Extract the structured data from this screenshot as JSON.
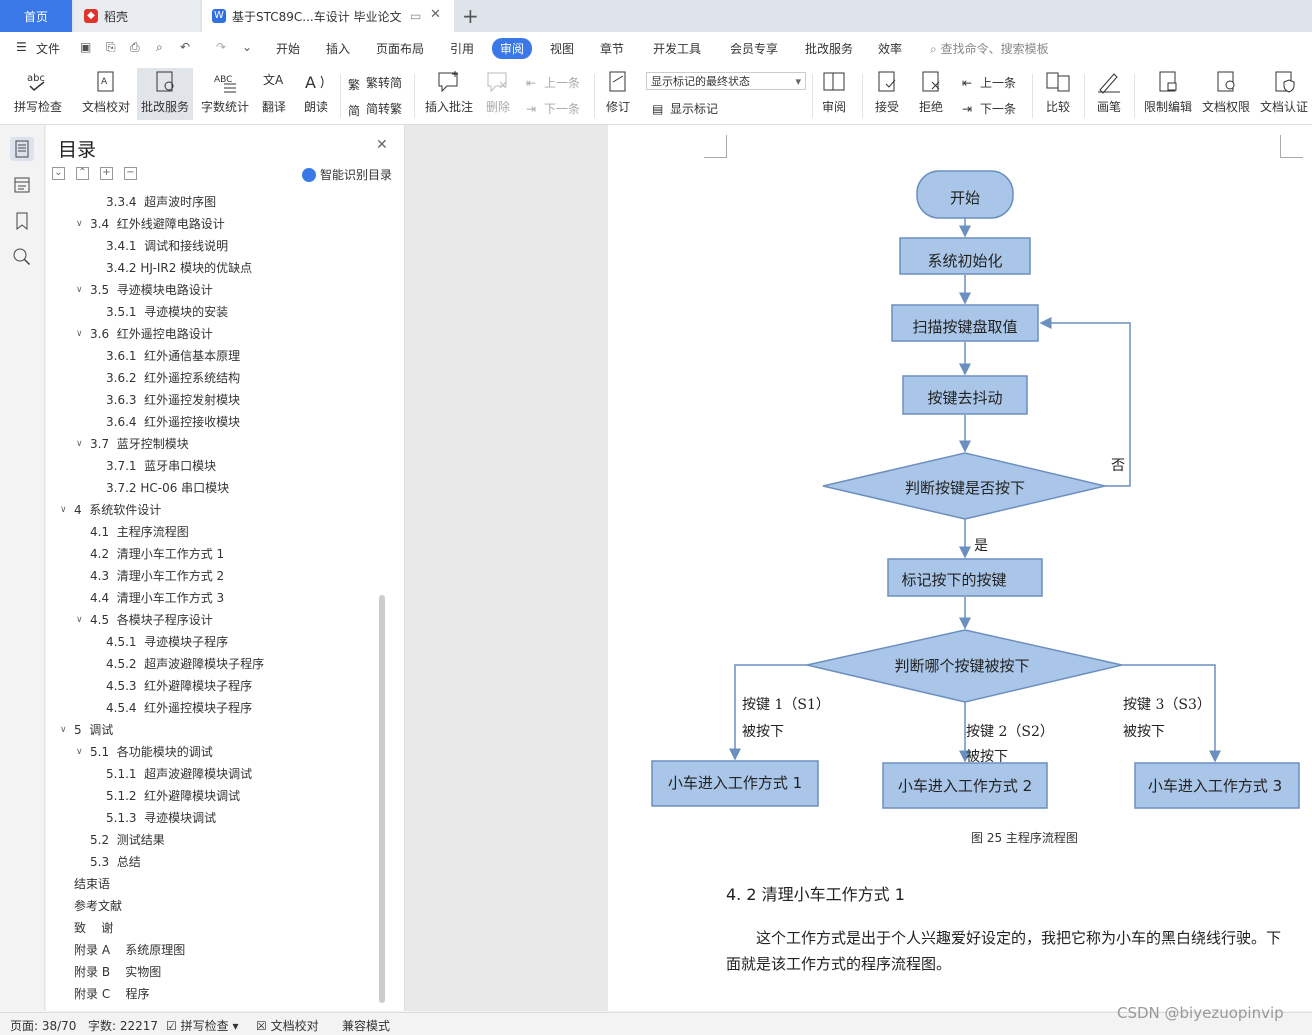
{
  "tabs": {
    "home": "首页",
    "daoke": "稻壳",
    "doc": "基于STC89C...车设计 毕业论文"
  },
  "menu": [
    "文件",
    "开始",
    "插入",
    "页面布局",
    "引用",
    "审阅",
    "视图",
    "章节",
    "开发工具",
    "会员专享",
    "批改服务",
    "效率"
  ],
  "search_placeholder": "查找命令、搜索模板",
  "ribbon": {
    "spell": "拼写检查",
    "proof": "文档校对",
    "correct": "批改服务",
    "wordcount": "字数统计",
    "translate": "翻译",
    "read": "朗读",
    "t2s": "繁转简",
    "s2t": "简转繁",
    "insert_comment": "插入批注",
    "delete": "删除",
    "prev": "上一条",
    "next": "下一条",
    "revise": "修订",
    "markup_state": "显示标记的最终状态",
    "show_markup": "显示标记",
    "review": "审阅",
    "accept": "接受",
    "reject": "拒绝",
    "prev2": "上一条",
    "next2": "下一条",
    "compare": "比较",
    "pen": "画笔",
    "restrict": "限制编辑",
    "perm": "文档权限",
    "auth": "文档认证"
  },
  "toc": {
    "title": "目录",
    "smart": "智能识别目录",
    "items": [
      {
        "text": "3.3.4  超声波时序图",
        "level": 3
      },
      {
        "text": "3.4  红外线避障电路设计",
        "level": 2,
        "expanded": true
      },
      {
        "text": "3.4.1  调试和接线说明",
        "level": 3
      },
      {
        "text": "3.4.2 HJ-IR2 模块的优缺点",
        "level": 3
      },
      {
        "text": "3.5  寻迹模块电路设计",
        "level": 2,
        "expanded": true
      },
      {
        "text": "3.5.1  寻迹模块的安装",
        "level": 3
      },
      {
        "text": "3.6  红外遥控电路设计",
        "level": 2,
        "expanded": true
      },
      {
        "text": "3.6.1  红外通信基本原理",
        "level": 3
      },
      {
        "text": "3.6.2  红外遥控系统结构",
        "level": 3
      },
      {
        "text": "3.6.3  红外遥控发射模块",
        "level": 3
      },
      {
        "text": "3.6.4  红外遥控接收模块",
        "level": 3
      },
      {
        "text": "3.7  蓝牙控制模块",
        "level": 2,
        "expanded": true
      },
      {
        "text": "3.7.1  蓝牙串口模块",
        "level": 3
      },
      {
        "text": "3.7.2 HC-06 串口模块",
        "level": 3
      },
      {
        "text": "4  系统软件设计",
        "level": 1,
        "expanded": true
      },
      {
        "text": "4.1  主程序流程图",
        "level": 2
      },
      {
        "text": "4.2  清理小车工作方式 1",
        "level": 2
      },
      {
        "text": "4.3  清理小车工作方式 2",
        "level": 2
      },
      {
        "text": "4.4  清理小车工作方式 3",
        "level": 2
      },
      {
        "text": "4.5  各模块子程序设计",
        "level": 2,
        "expanded": true
      },
      {
        "text": "4.5.1  寻迹模块子程序",
        "level": 3
      },
      {
        "text": "4.5.2  超声波避障模块子程序",
        "level": 3
      },
      {
        "text": "4.5.3  红外避障模块子程序",
        "level": 3
      },
      {
        "text": "4.5.4  红外遥控模块子程序",
        "level": 3
      },
      {
        "text": "5  调试",
        "level": 1,
        "expanded": true
      },
      {
        "text": "5.1  各功能模块的调试",
        "level": 2,
        "expanded": true
      },
      {
        "text": "5.1.1  超声波避障模块调试",
        "level": 3
      },
      {
        "text": "5.1.2  红外避障模块调试",
        "level": 3
      },
      {
        "text": "5.1.3  寻迹模块调试",
        "level": 3
      },
      {
        "text": "5.2  测试结果",
        "level": 2
      },
      {
        "text": "5.3  总结",
        "level": 2
      },
      {
        "text": "结束语",
        "level": 1
      },
      {
        "text": "参考文献",
        "level": 1
      },
      {
        "text": "致    谢",
        "level": 1
      },
      {
        "text": "附录 A    系统原理图",
        "level": 1
      },
      {
        "text": "附录 B    实物图",
        "level": 1
      },
      {
        "text": "附录 C    程序",
        "level": 1
      }
    ]
  },
  "flowchart": {
    "start": "开始",
    "init": "系统初始化",
    "scan": "扫描按键盘取值",
    "debounce": "按键去抖动",
    "pressed": "判断按键是否按下",
    "no": "否",
    "yes": "是",
    "mark": "标记按下的按键",
    "which": "判断哪个按键被按下",
    "k1a": "按键 1（S1）",
    "k1b": "被按下",
    "k2a": "按键 2（S2）",
    "k2b": "被按下",
    "k3a": "按键 3（S3）",
    "k3b": "被按下",
    "m1": "小车进入工作方式 1",
    "m2": "小车进入工作方式 2",
    "m3": "小车进入工作方式 3"
  },
  "caption": "图 25  主程序流程图",
  "section_heading": "4. 2  清理小车工作方式 1",
  "paragraph": "这个工作方式是出于个人兴趣爱好设定的，我把它称为小车的黑白绕线行驶。下面就是该工作方式的程序流程图。",
  "status": {
    "page": "页面: 38/70",
    "words": "字数: 22217",
    "spell": "拼写检查",
    "proof": "文档校对",
    "compat": "兼容模式"
  },
  "watermark": "CSDN @biyezuopinvip",
  "colors": {
    "accent": "#3b78e7",
    "flow_fill": "#a9c6e8",
    "flow_stroke": "#6b8fbf"
  }
}
